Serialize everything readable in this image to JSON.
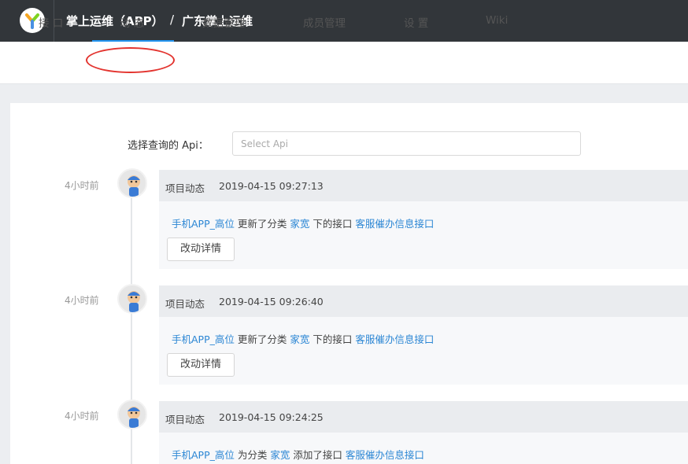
{
  "header": {
    "project_title": "掌上运维（APP）",
    "separator": "/",
    "group_name": "广东掌上运维"
  },
  "tabs": [
    {
      "label": "接 口"
    },
    {
      "label": "动 态"
    },
    {
      "label": "数据管理"
    },
    {
      "label": "成员管理"
    },
    {
      "label": "设 置"
    },
    {
      "label": "Wiki"
    }
  ],
  "active_tab": "动 态",
  "filter": {
    "label": "选择查询的 Api：",
    "placeholder": "Select Api"
  },
  "timeline": [
    {
      "relative_time": "4小时前",
      "type": "项目动态",
      "timestamp": "2019-04-15 09:27:13",
      "user": "手机APP_高位",
      "text1": " 更新了分类 ",
      "category": "家宽",
      "text2": " 下的接口 ",
      "api": "客服催办信息接口",
      "button": "改动详情"
    },
    {
      "relative_time": "4小时前",
      "type": "项目动态",
      "timestamp": "2019-04-15 09:26:40",
      "user": "手机APP_高位",
      "text1": " 更新了分类 ",
      "category": "家宽",
      "text2": " 下的接口 ",
      "api": "客服催办信息接口",
      "button": "改动详情"
    },
    {
      "relative_time": "4小时前",
      "type": "项目动态",
      "timestamp": "2019-04-15 09:24:25",
      "user": "手机APP_高位",
      "text1": " 为分类 ",
      "category": "家宽",
      "text2": " 添加了接口 ",
      "api": "客服催办信息接口",
      "button": ""
    }
  ],
  "colors": {
    "topbar": "#32363a",
    "accent": "#2395f1",
    "link": "#2b86d4",
    "annotation": "#e3342f"
  }
}
